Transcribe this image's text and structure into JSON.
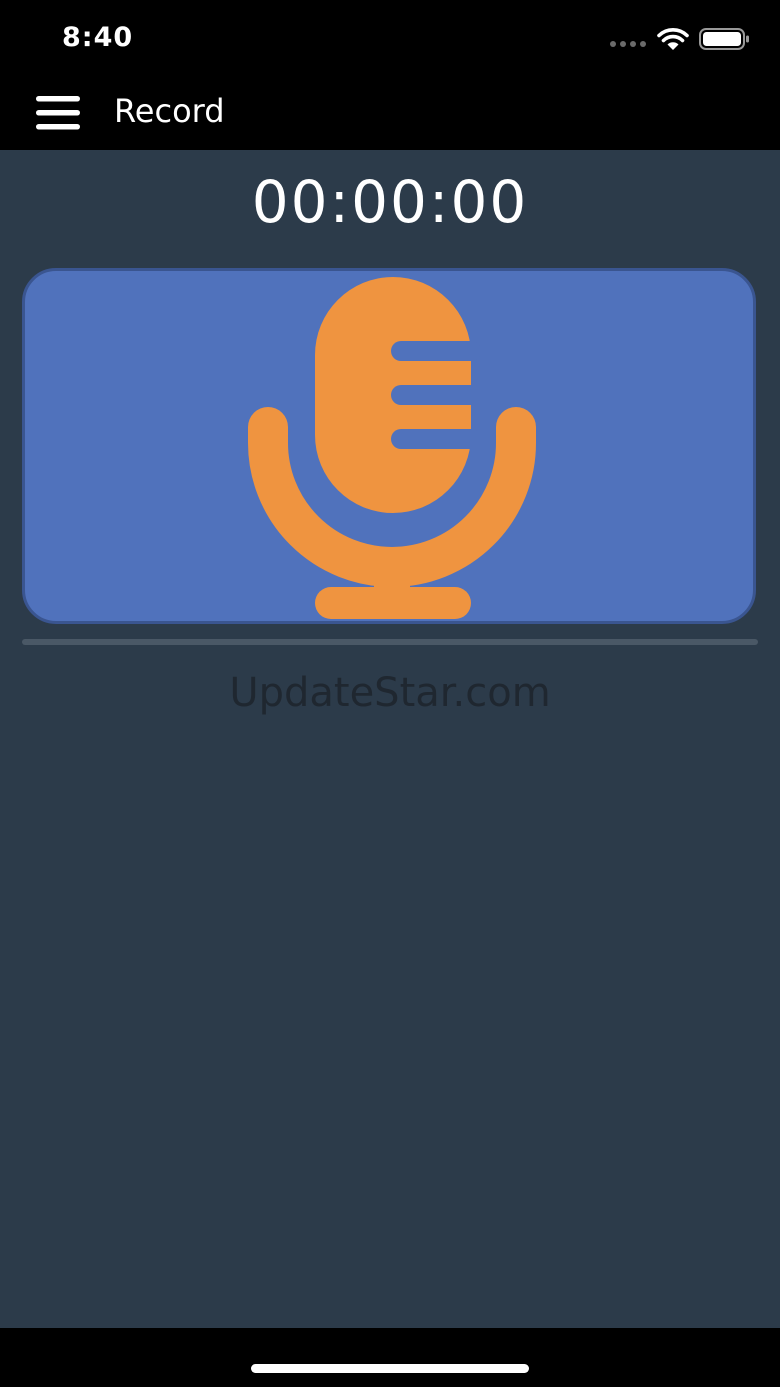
{
  "status_bar": {
    "time": "8:40",
    "icons": [
      "signal-icon",
      "wifi-icon",
      "battery-icon"
    ]
  },
  "nav": {
    "menu_icon": "hamburger-menu-icon",
    "title": "Record"
  },
  "recorder": {
    "timer": "00:00:00",
    "mic_icon": "microphone-icon",
    "progress": 0
  },
  "watermark": "UpdateStar.com",
  "colors": {
    "background": "#2c3b4a",
    "record_button": "#5072bc",
    "mic": "#ef9440",
    "bars": "#000000"
  }
}
